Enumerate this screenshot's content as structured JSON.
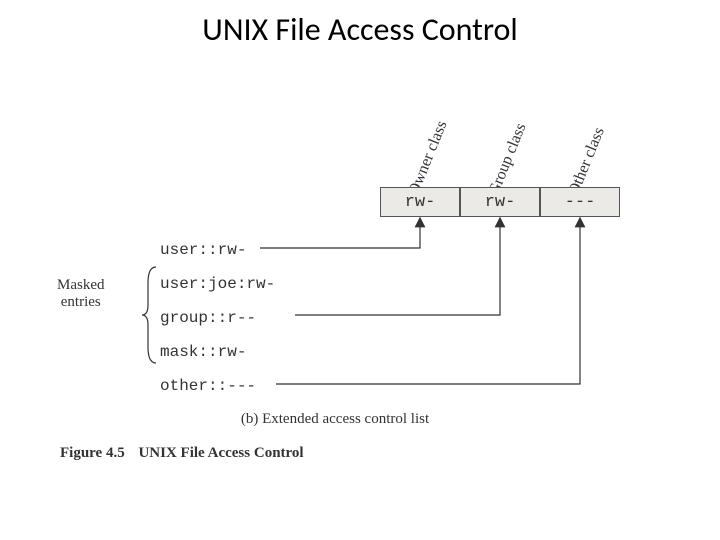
{
  "title": "UNIX File Access Control",
  "classes": {
    "owner": {
      "label": "Owner class",
      "perm": "rw-"
    },
    "group": {
      "label": "Group class",
      "perm": "rw-"
    },
    "other": {
      "label": "Other class",
      "perm": "---"
    }
  },
  "acl_entries": [
    "user::rw-",
    "user:joe:rw-",
    "group::r--",
    "mask::rw-",
    "other::---"
  ],
  "masked_label_line1": "Masked",
  "masked_label_line2": "entries",
  "caption": "(b) Extended access control list",
  "figure_number": "Figure 4.5",
  "figure_title": "UNIX File Access Control"
}
